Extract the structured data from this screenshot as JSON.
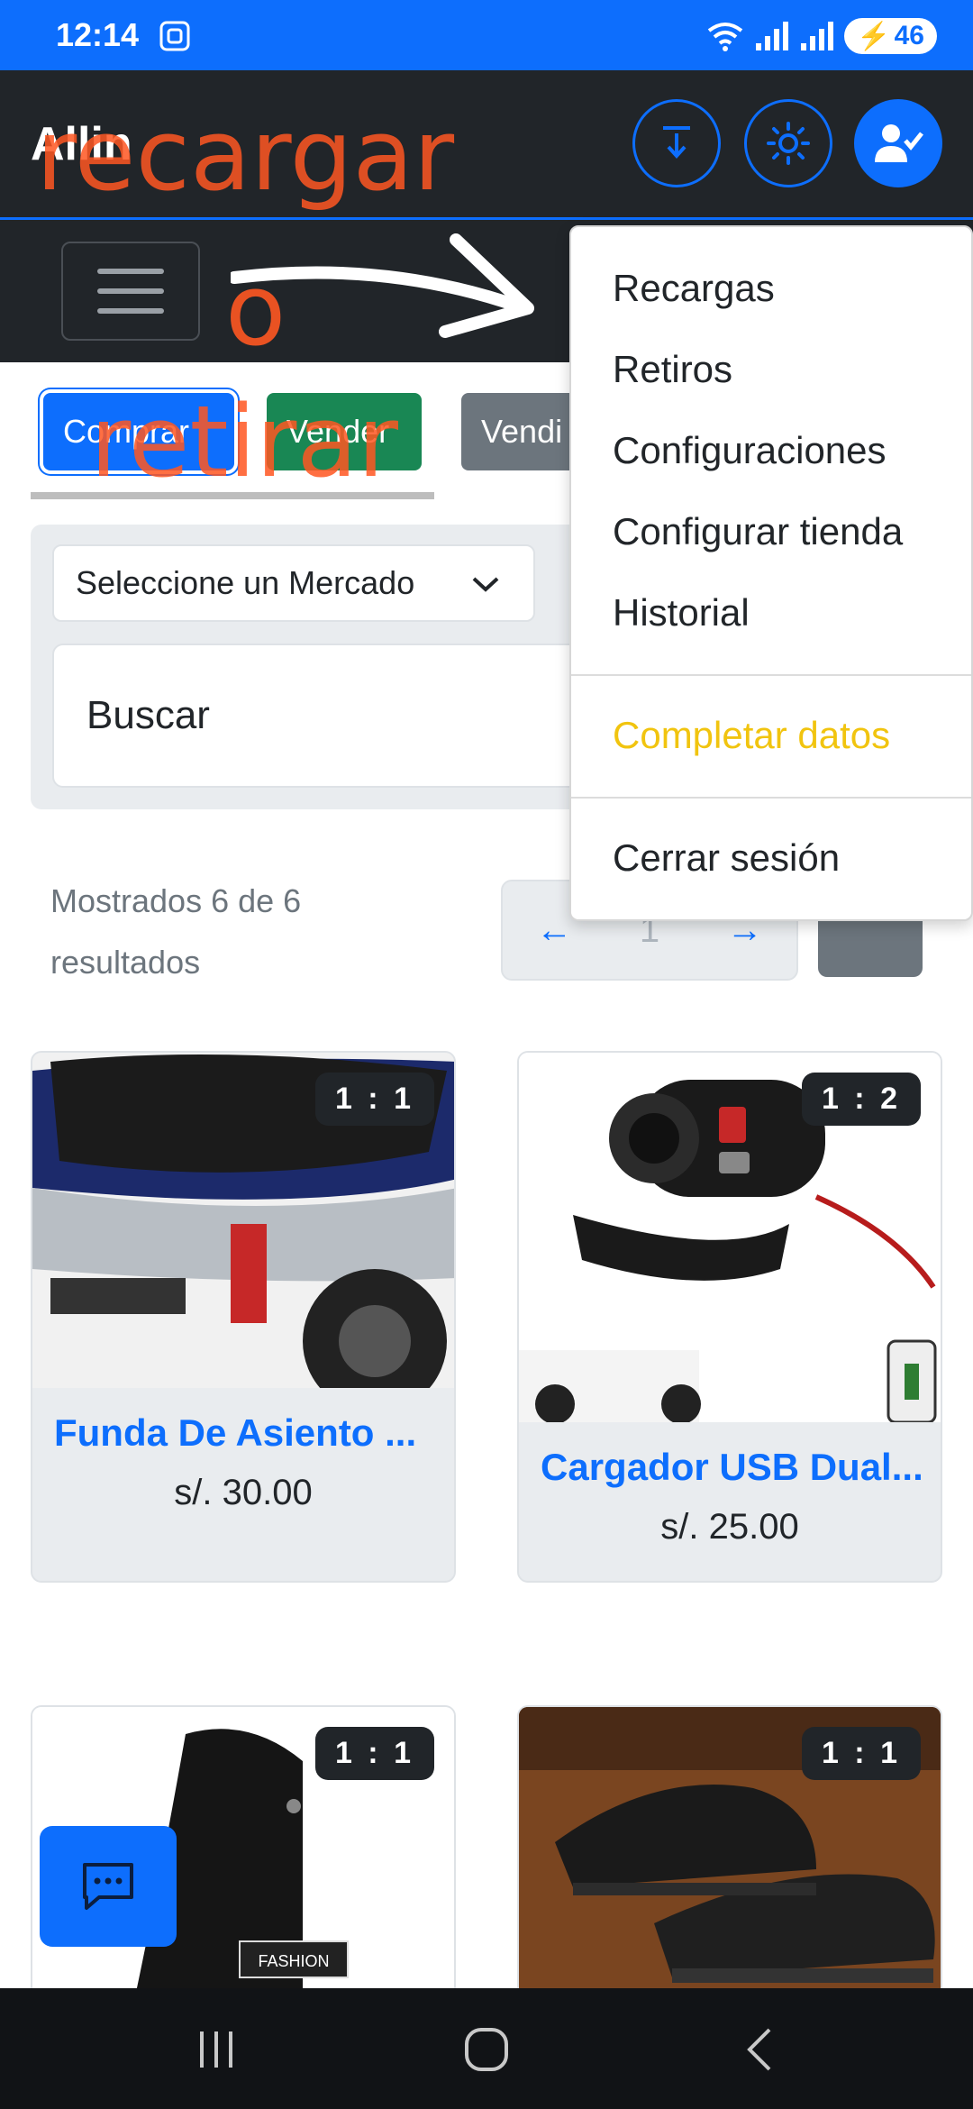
{
  "status_bar": {
    "time": "12:14",
    "battery": "46",
    "background": "#0d6efd"
  },
  "topnav": {
    "brand": "Allin",
    "overlay_recargar": "recargar"
  },
  "subnav": {
    "overlay_o": "o"
  },
  "tabs": {
    "buy": "Comprar",
    "sell": "Vender",
    "sold": "Vendi",
    "overlay_retirar": "retirar"
  },
  "filters": {
    "market_select": "Seleccione un Mercado",
    "search_placeholder": "Buscar"
  },
  "results": {
    "text": "Mostrados 6 de 6 resultados",
    "page_number": "1",
    "prev": "←",
    "next": "→"
  },
  "products": [
    {
      "title": "Funda De Asiento ...",
      "price": "s/. 30.00",
      "ratio": "1 : 1"
    },
    {
      "title": "Cargador USB Dual...",
      "price": "s/. 25.00",
      "ratio": "1 : 2"
    },
    {
      "title": "",
      "price": "",
      "ratio": "1 : 1",
      "bag_label": "FASHION"
    },
    {
      "title": "",
      "price": "",
      "ratio": "1 : 1"
    }
  ],
  "dropdown": {
    "items": [
      "Recargas",
      "Retiros",
      "Configuraciones",
      "Configurar tienda",
      "Historial"
    ],
    "complete": "Completar datos",
    "logout": "Cerrar sesión"
  },
  "colors": {
    "primary": "#0d6efd",
    "success": "#198754",
    "secondary": "#6c757d",
    "dark": "#212529",
    "annotation": "#ff5722",
    "warning": "#f1c40f"
  },
  "icons": [
    "screenshot-icon",
    "wifi-icon",
    "signal-icon",
    "download-icon",
    "sun-icon",
    "user-check-icon",
    "chevron-down-icon",
    "arrow-left-icon",
    "arrow-right-icon",
    "list-icon",
    "chat-icon",
    "recent-apps-icon",
    "home-icon",
    "back-icon"
  ]
}
